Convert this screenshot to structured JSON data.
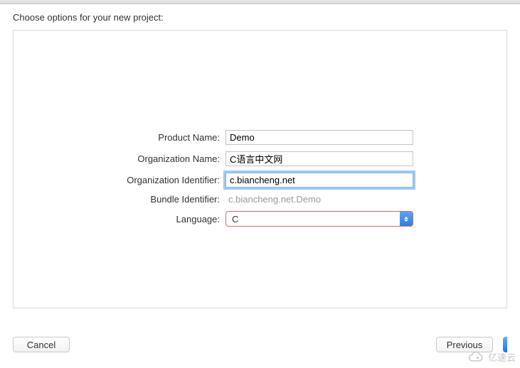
{
  "header": {
    "title": "Choose options for your new project:"
  },
  "form": {
    "productName": {
      "label": "Product Name:",
      "value": "Demo"
    },
    "orgName": {
      "label": "Organization Name:",
      "value": "C语言中文网"
    },
    "orgId": {
      "label": "Organization Identifier:",
      "value": "c.biancheng.net"
    },
    "bundleId": {
      "label": "Bundle Identifier:",
      "value": "c.biancheng.net.Demo"
    },
    "language": {
      "label": "Language:",
      "value": "C"
    }
  },
  "footer": {
    "cancel": "Cancel",
    "previous": "Previous"
  },
  "watermark": {
    "text": "亿速云"
  }
}
